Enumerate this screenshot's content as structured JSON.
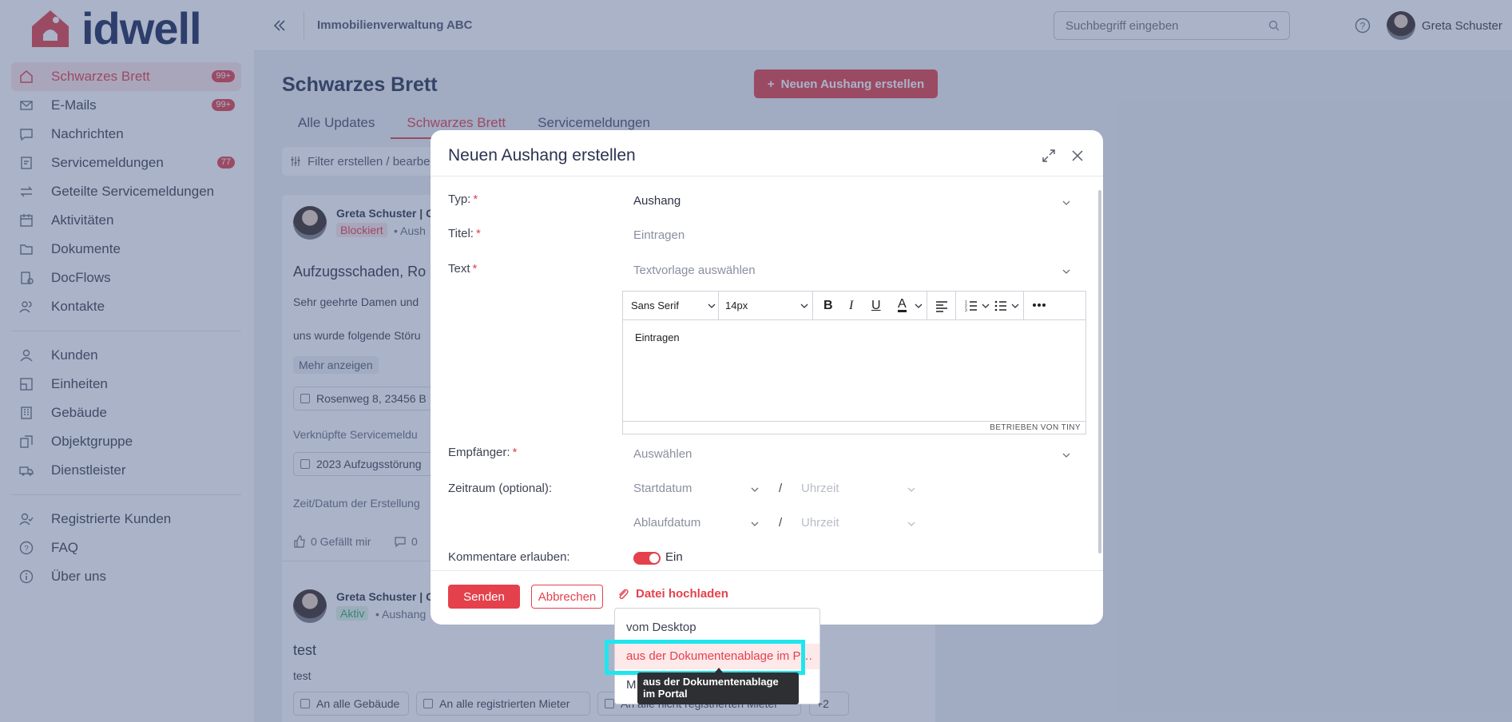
{
  "brand": {
    "logo_text": "idwell",
    "accent": "#e4414c",
    "logo_color": "#1c2a5a"
  },
  "sidebar": {
    "items": [
      {
        "label": "Schwarzes Brett",
        "icon": "home-icon",
        "badge": "99+",
        "active": true
      },
      {
        "label": "E-Mails",
        "icon": "mail-icon",
        "badge": "99+"
      },
      {
        "label": "Nachrichten",
        "icon": "chat-icon"
      },
      {
        "label": "Servicemeldungen",
        "icon": "service-icon",
        "badge": "77"
      },
      {
        "label": "Geteilte Servicemeldungen",
        "icon": "share-arrows-icon"
      },
      {
        "label": "Aktivitäten",
        "icon": "calendar-icon"
      },
      {
        "label": "Dokumente",
        "icon": "folder-icon"
      },
      {
        "label": "DocFlows",
        "icon": "docflow-icon"
      },
      {
        "label": "Kontakte",
        "icon": "contacts-icon"
      }
    ],
    "items2": [
      {
        "label": "Kunden",
        "icon": "person-icon"
      },
      {
        "label": "Einheiten",
        "icon": "unit-icon"
      },
      {
        "label": "Gebäude",
        "icon": "building-icon"
      },
      {
        "label": "Objektgruppe",
        "icon": "group-icon"
      },
      {
        "label": "Dienstleister",
        "icon": "truck-icon"
      }
    ],
    "items3": [
      {
        "label": "Registrierte Kunden",
        "icon": "person-check-icon"
      },
      {
        "label": "FAQ",
        "icon": "question-icon"
      },
      {
        "label": "Über uns",
        "icon": "info-icon"
      }
    ]
  },
  "header": {
    "org": "Immobilienverwaltung ABC",
    "search_placeholder": "Suchbegriff eingeben",
    "user_name": "Greta Schuster"
  },
  "main": {
    "title": "Schwarzes Brett",
    "create_button": "Neuen Aushang erstellen",
    "tabs": [
      "Alle Updates",
      "Schwarzes Brett",
      "Servicemeldungen"
    ],
    "filter": "Filter erstellen / bearbe",
    "post1": {
      "author": "Greta Schuster | G",
      "status": "Blockiert",
      "meta": "• Aush",
      "title": "Aufzugsschaden, Ro",
      "line1": "Sehr geehrte Damen und",
      "line2": "uns wurde folgende Störu",
      "more": "Mehr anzeigen",
      "address": "Rosenweg 8, 23456 B",
      "linked_label": "Verknüpfte Servicemeldu",
      "linked_item": "2023 Aufzugsstörung",
      "created_label": "Zeit/Datum der Erstellung",
      "likes": "0 Gefällt mir",
      "comments": "0"
    },
    "post2": {
      "author": "Greta Schuster | G",
      "status": "Aktiv",
      "meta": "• Aushang",
      "title": "test",
      "body": "test",
      "chips": [
        "An alle Gebäude",
        "An alle registrierten Mieter",
        "An alle nicht registrierten Mieter",
        "+2"
      ]
    }
  },
  "modal": {
    "title": "Neuen Aushang erstellen",
    "fields": {
      "type_label": "Typ:",
      "type_value": "Aushang",
      "title_label": "Titel:",
      "title_placeholder": "Eintragen",
      "text_label": "Text",
      "text_template_placeholder": "Textvorlage auswählen",
      "recipient_label": "Empfänger:",
      "recipient_placeholder": "Auswählen",
      "period_label": "Zeitraum (optional):",
      "start_date": "Startdatum",
      "end_date": "Ablaufdatum",
      "time_placeholder": "Uhrzeit",
      "slash": "/",
      "comments_label": "Kommentare erlauben:",
      "comments_value": "Ein",
      "required_mark": "*"
    },
    "editor": {
      "font": "Sans Serif",
      "size": "14px",
      "body_placeholder": "Eintragen",
      "brand": "BETRIEBEN VON TINY"
    },
    "buttons": {
      "send": "Senden",
      "cancel": "Abbrechen",
      "upload": "Datei hochladen"
    }
  },
  "upload_menu": {
    "items": [
      "vom Desktop",
      "aus der Dokumentenablage im P…",
      "M"
    ],
    "tooltip": "aus der Dokumentenablage im Portal"
  }
}
